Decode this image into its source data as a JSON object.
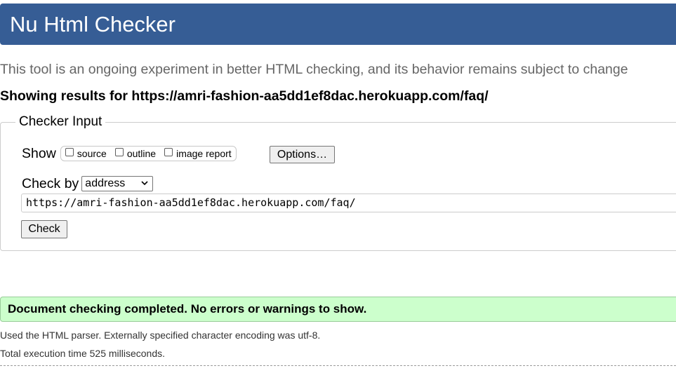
{
  "header": {
    "title": "Nu Html Checker"
  },
  "intro": "This tool is an ongoing experiment in better HTML checking, and its behavior remains subject to change",
  "showing_results": "Showing results for https://amri-fashion-aa5dd1ef8dac.herokuapp.com/faq/",
  "checker_input": {
    "legend": "Checker Input",
    "show_label": "Show",
    "options": [
      {
        "label": "source",
        "checked": false
      },
      {
        "label": "outline",
        "checked": false
      },
      {
        "label": "image report",
        "checked": false
      }
    ],
    "options_button": "Options…",
    "check_by_label": "Check by",
    "check_by_selected": "address",
    "url_value": "https://amri-fashion-aa5dd1ef8dac.herokuapp.com/faq/",
    "check_button": "Check"
  },
  "result": {
    "message": "Document checking completed. No errors or warnings to show.",
    "parser_note": "Used the HTML parser. Externally specified character encoding was utf-8.",
    "execution_time": "Total execution time 525 milliseconds."
  },
  "colors": {
    "header_bg": "#365d95",
    "success_bg": "#ccffcc"
  }
}
